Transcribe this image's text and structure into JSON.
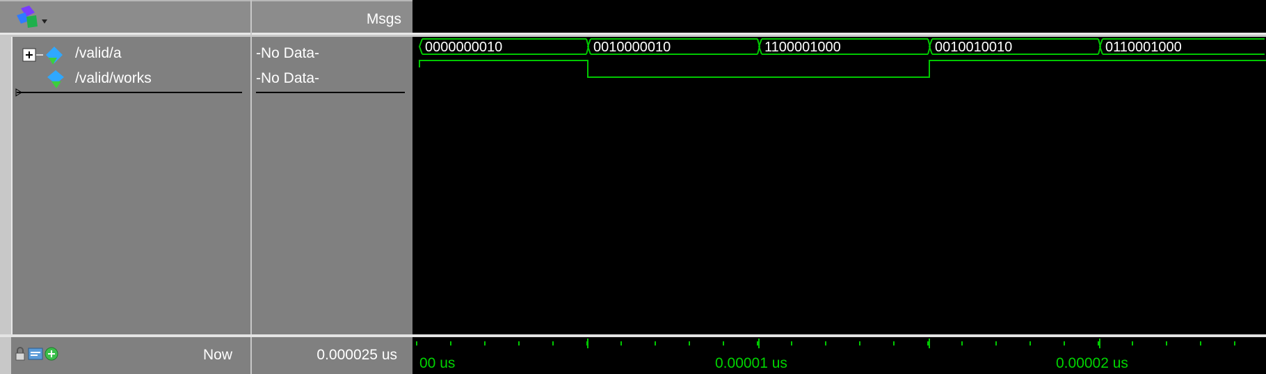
{
  "header": {
    "msgs_label": "Msgs"
  },
  "signals": [
    {
      "name": "/valid/a",
      "value": "-No Data-"
    },
    {
      "name": "/valid/works",
      "value": "-No Data-"
    }
  ],
  "bus_values": [
    "0000000010",
    "0010000010",
    "1100001000",
    "0010010010",
    "0110001000"
  ],
  "footer": {
    "now_label": "Now",
    "now_value": "0.000025 us",
    "time_labels": [
      "00 us",
      "0.00001 us",
      "0.00002 us"
    ]
  },
  "colors": {
    "wave": "#00c800",
    "background": "#000000",
    "pane": "#808080"
  },
  "icons": [
    "wave-window-icon",
    "expand-plus-icon",
    "bus-signal-icon",
    "signal-icon",
    "lock-icon",
    "zoom-icon",
    "add-cursor-icon"
  ]
}
